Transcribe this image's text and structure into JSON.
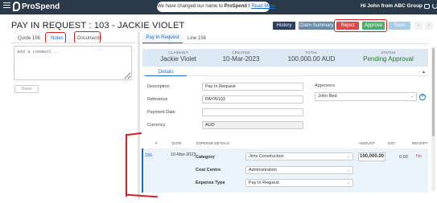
{
  "topbar": {
    "brand": "ProSpend",
    "notice_text": "We have changed our name to",
    "notice_brand": "ProSpend !",
    "notice_link": "Read More",
    "greeting": "Hi John from ABC Group"
  },
  "page": {
    "title": "PAY IN REQUEST : 103 - JACKIE VIOLET"
  },
  "actions": {
    "history": "History",
    "claim_summary": "Claim Summary",
    "reject": "Reject",
    "approve": "Approve",
    "save": "Save",
    "prev": "‹",
    "next": "›"
  },
  "left_tabs": {
    "quote": "Quote 156",
    "notes": "Notes",
    "documents": "Documents"
  },
  "comment": {
    "placeholder": "Add a comment...",
    "save": "Save"
  },
  "right_tabs": {
    "pay_in_request": "Pay In Request",
    "line": "Line 156"
  },
  "summary": {
    "claimant_label": "CLAIMANT",
    "claimant": "Jackie Violet",
    "created_label": "CREATED",
    "created": "10-Mar-2023",
    "total_label": "TOTAL",
    "total": "100,000.00 AUD",
    "status_label": "STATUS",
    "status": "Pending Approval"
  },
  "details": {
    "tab": "Details",
    "collapse": "▴",
    "description_label": "Description",
    "description": "Pay In Request",
    "reference_label": "Reference",
    "reference": "PAYIN103",
    "payment_date_label": "Payment Date",
    "payment_date": "",
    "currency_label": "Currency",
    "currency": "AUD",
    "approvers_label": "Approvers",
    "approver": "John Red"
  },
  "grid": {
    "headers": {
      "num": "#",
      "date": "DATE",
      "expense_details": "EXPENSE DETAILS",
      "amount": "AMOUNT",
      "gst": "GST",
      "receipt": "RECEIPT"
    },
    "row": {
      "id": "156",
      "date": "10-Mar-2023",
      "category_label": "Category",
      "category": "Jims Construction",
      "cost_centre_label": "Cost Centre",
      "cost_centre": "Administration",
      "expense_type_label": "Expense Type",
      "expense_type": "Pay In Request",
      "amount": "100,000.00",
      "gst": "0.00",
      "receipt": "No"
    }
  },
  "colors": {
    "topbar": "#2b3a4a",
    "accent": "#1a6bd0",
    "reject": "#e04848",
    "approve": "#4caf6a",
    "annotation": "#d41f1f"
  }
}
